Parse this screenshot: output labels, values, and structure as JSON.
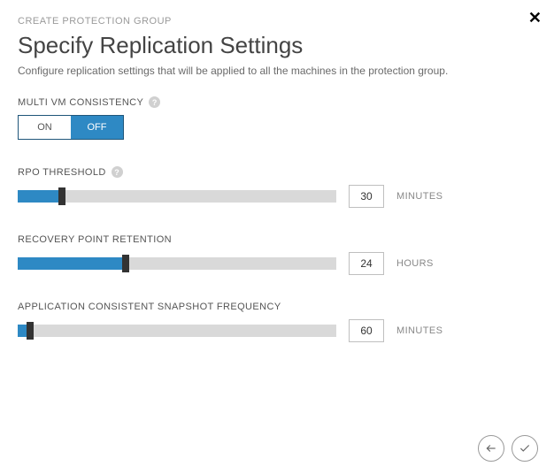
{
  "breadcrumb": "CREATE PROTECTION GROUP",
  "title": "Specify Replication Settings",
  "subtitle": "Configure replication settings that will be applied to all the machines in the protection group.",
  "multi_vm": {
    "label": "MULTI VM CONSISTENCY",
    "on_label": "ON",
    "off_label": "OFF",
    "value": "OFF"
  },
  "rpo": {
    "label": "RPO THRESHOLD",
    "value": "30",
    "unit": "MINUTES",
    "fill_pct": 14
  },
  "retention": {
    "label": "RECOVERY POINT RETENTION",
    "value": "24",
    "unit": "HOURS",
    "fill_pct": 34
  },
  "snapshot": {
    "label": "APPLICATION CONSISTENT SNAPSHOT FREQUENCY",
    "value": "60",
    "unit": "MINUTES",
    "fill_pct": 4
  }
}
